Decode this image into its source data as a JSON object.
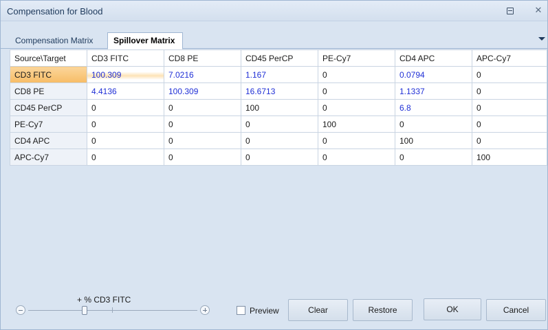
{
  "window": {
    "title": "Compensation for Blood"
  },
  "tabs": {
    "compensation_label": "Compensation Matrix",
    "spillover_label": "Spillover Matrix"
  },
  "matrix": {
    "corner_label": "Source\\Target",
    "columns": [
      "CD3 FITC",
      "CD8 PE",
      "CD45 PerCP",
      "PE-Cy7",
      "CD4 APC",
      "APC-Cy7"
    ],
    "rows": [
      {
        "label": "CD3 FITC",
        "values": [
          "100.309",
          "7.0216",
          "1.167",
          "0",
          "0.0794",
          "0"
        ]
      },
      {
        "label": "CD8 PE",
        "values": [
          "4.4136",
          "100.309",
          "16.6713",
          "0",
          "1.1337",
          "0"
        ]
      },
      {
        "label": "CD45 PerCP",
        "values": [
          "0",
          "0",
          "100",
          "0",
          "6.8",
          "0"
        ]
      },
      {
        "label": "PE-Cy7",
        "values": [
          "0",
          "0",
          "0",
          "100",
          "0",
          "0"
        ]
      },
      {
        "label": "CD4 APC",
        "values": [
          "0",
          "0",
          "0",
          "0",
          "100",
          "0"
        ]
      },
      {
        "label": "APC-Cy7",
        "values": [
          "0",
          "0",
          "0",
          "0",
          "0",
          "100"
        ]
      }
    ],
    "highlight_color": "#1f2fd6",
    "selected_color": "#f7bc66"
  },
  "slider": {
    "label": "+ % CD3 FITC"
  },
  "preview": {
    "label": "Preview",
    "checked": false
  },
  "buttons": {
    "clear": "Clear",
    "restore": "Restore",
    "ok": "OK",
    "cancel": "Cancel"
  }
}
